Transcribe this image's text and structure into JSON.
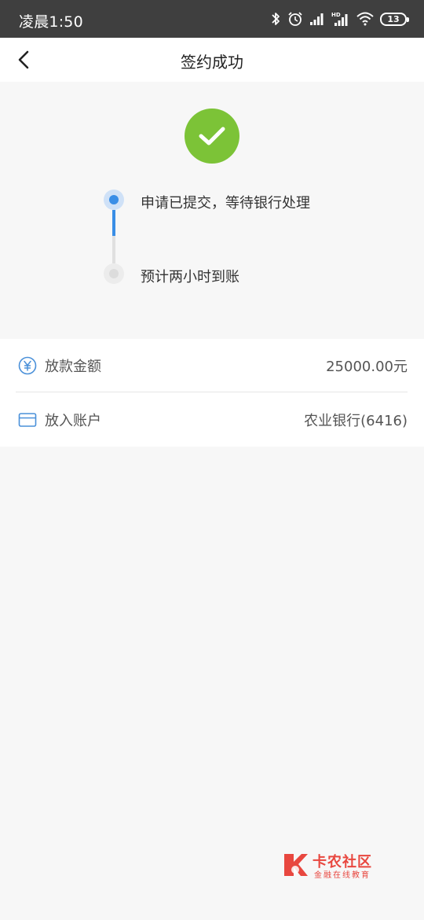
{
  "status_bar": {
    "time": "凌晨1:50",
    "battery_level": "13",
    "network_label": "HD"
  },
  "navbar": {
    "title": "签约成功"
  },
  "steps": [
    {
      "label": "申请已提交，等待银行处理",
      "state": "active"
    },
    {
      "label": "预计两小时到账",
      "state": "pending"
    }
  ],
  "info": {
    "amount_label": "放款金额",
    "amount_value": "25000.00元",
    "account_label": "放入账户",
    "account_value": "农业银行(6416)"
  },
  "watermark": {
    "title": "卡农社区",
    "subtitle": "金融在线教育"
  },
  "colors": {
    "success_green": "#7cc337",
    "active_blue": "#3a8ee6",
    "statusbar_bg": "#3f3f3f",
    "watermark_red": "#e8473f"
  },
  "icons": {
    "back": "chevron-left-icon",
    "success": "check-circle-icon",
    "amount": "yuan-icon",
    "account": "card-icon"
  }
}
